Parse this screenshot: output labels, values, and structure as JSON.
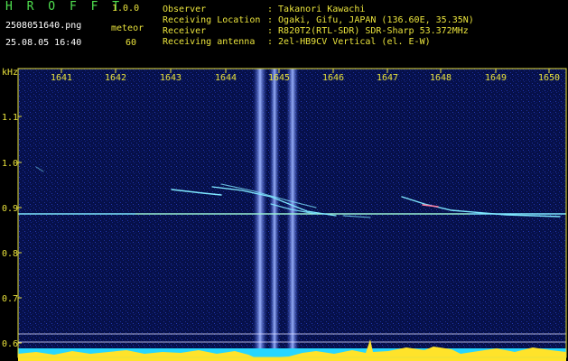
{
  "app": {
    "name": "H R O F F T",
    "version": "1.0.0"
  },
  "file": {
    "filename": "2508051640.png",
    "datetime": "25.08.05 16:40",
    "mode_label": "meteor",
    "count": "60"
  },
  "info": {
    "rows": [
      {
        "label": "Observer",
        "value": ": Takanori Kawachi"
      },
      {
        "label": "Receiving Location",
        "value": ": Ogaki, Gifu, JAPAN (136.60E, 35.35N)"
      },
      {
        "label": "Receiver",
        "value": ": R820T2(RTL-SDR) SDR-Sharp 53.372MHz"
      },
      {
        "label": "Receiving antenna",
        "value": ": 2el-HB9CV Vertical (el. E-W)"
      }
    ]
  },
  "axes": {
    "unit": "kHz",
    "x_ticks": [
      "1641",
      "1642",
      "1643",
      "1644",
      "1645",
      "1646",
      "1647",
      "1648",
      "1649",
      "1650"
    ],
    "y_ticks": [
      "1.1",
      "1.0",
      "0.9",
      "0.8",
      "0.7",
      "0.6"
    ]
  },
  "colors": {
    "background": "#000000",
    "spectrum_bg": "#07114a",
    "header_yellow": "#e9e23c",
    "logo_green": "#4fe04f",
    "signal_cyan": "#7fe8ff",
    "band_blue": "#6a8cff",
    "power_yellow": "#ffe32a",
    "power_cyan": "#27d6ff"
  }
}
